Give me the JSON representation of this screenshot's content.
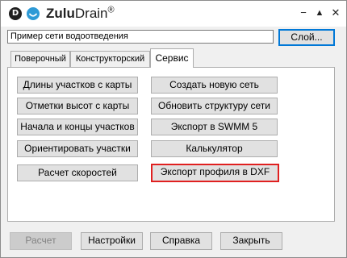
{
  "titlebar": {
    "logo_letter": "D",
    "app_name_bold": "Zulu",
    "app_name_rest": "Drain",
    "reg_mark": "®",
    "minimize_symbol": "−",
    "collapse_symbol": "▲",
    "close_symbol": "✕"
  },
  "project": {
    "name": "Пример сети водоотведения",
    "layer_button": "Слой..."
  },
  "tabs": [
    {
      "label": "Поверочный",
      "active": false
    },
    {
      "label": "Конструкторский",
      "active": false
    },
    {
      "label": "Сервис",
      "active": true
    }
  ],
  "service_buttons": {
    "lengths": "Длины участков с карты",
    "heights": "Отметки высот с карты",
    "endpoints": "Начала и концы участков",
    "orient": "Ориентировать участки",
    "speeds": "Расчет скоростей",
    "new_network": "Создать новую сеть",
    "update_structure": "Обновить структуру сети",
    "export_swmm": "Экспорт в SWMM 5",
    "calculator": "Калькулятор",
    "export_dxf": "Экспорт профиля в DXF"
  },
  "bottom_buttons": {
    "calculate": "Расчет",
    "settings": "Настройки",
    "help": "Справка",
    "close": "Закрыть"
  },
  "colors": {
    "selection_border": "#0078d7",
    "highlight_border": "#e02020",
    "logo_blue": "#2e9ad6"
  }
}
